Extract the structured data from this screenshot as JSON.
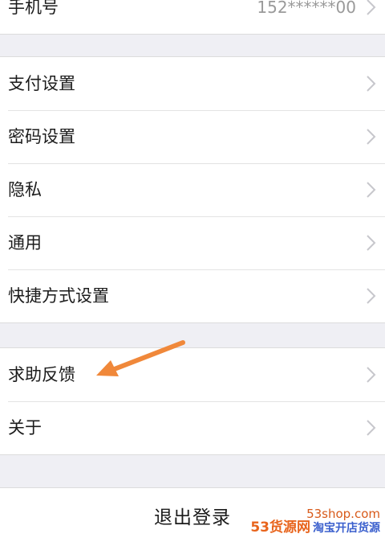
{
  "group1": {
    "items": [
      {
        "label": "手机号",
        "value": "152******00"
      }
    ]
  },
  "group2": {
    "items": [
      {
        "label": "支付设置"
      },
      {
        "label": "密码设置"
      },
      {
        "label": "隐私"
      },
      {
        "label": "通用"
      },
      {
        "label": "快捷方式设置"
      }
    ]
  },
  "group3": {
    "items": [
      {
        "label": "求助反馈"
      },
      {
        "label": "关于"
      }
    ]
  },
  "logout": {
    "label": "退出登录"
  },
  "annotation": {
    "arrow_color": "#f0883a",
    "points_to": "求助反馈"
  },
  "watermark": {
    "url": "53shop.com",
    "brand": "53货源网",
    "slogan": "淘宝开店货源",
    "brand_color": "#e8641c",
    "slogan_color": "#3a5fcd"
  },
  "colors": {
    "background": "#efeff4",
    "row_bg": "#ffffff",
    "text": "#1c1c1c",
    "value_text": "#9a9a9a",
    "chevron": "#c7c7cc"
  }
}
